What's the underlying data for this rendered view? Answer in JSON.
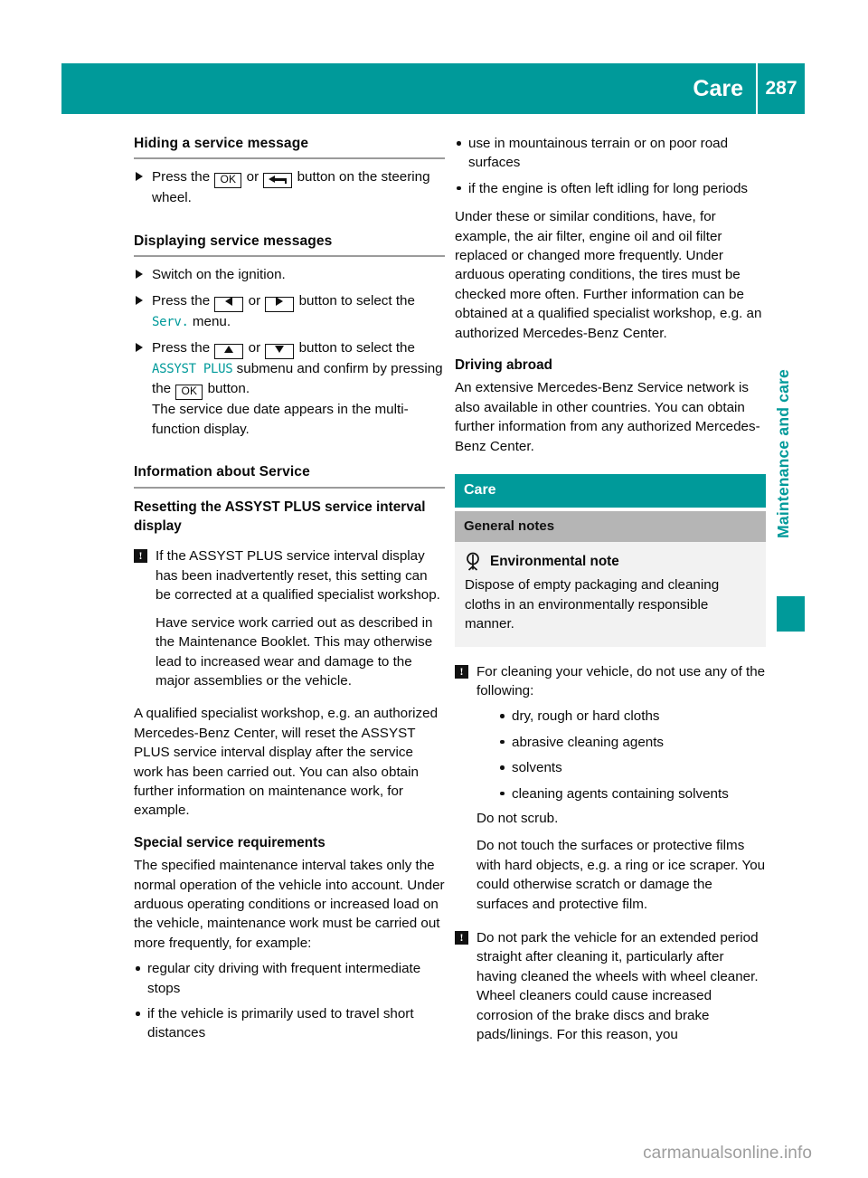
{
  "header": {
    "title": "Care",
    "page_number": "287"
  },
  "left_column": {
    "section1": {
      "heading": "Hiding a service message",
      "step1_pre": "Press the",
      "step1_key_ok": "OK",
      "step1_or": "or",
      "step1_key_back": "back-arrow-button",
      "step1_post": "button on the steering wheel."
    },
    "section2": {
      "heading": "Displaying service messages",
      "step1": "Switch on the ignition.",
      "step2_pre": "Press the",
      "step2_key_left": "left-arrow-button",
      "step2_or": "or",
      "step2_key_right": "right-arrow-button",
      "step2_mid": "button to select the",
      "step2_display": "Serv.",
      "step2_post": "menu.",
      "step3_pre": "Press the",
      "step3_key_up": "up-arrow-button",
      "step3_or": "or",
      "step3_key_down": "down-arrow-button",
      "step3_mid": "button to select the",
      "step3_display": "ASSYST PLUS",
      "step3_post": "submenu and confirm by pressing the",
      "step3_key_ok": "OK",
      "step3_tail": "button.",
      "step3_result": "The service due date appears in the multi-function display."
    },
    "section3": {
      "heading": "Information about Service",
      "sub_heading": "Resetting the ASSYST PLUS service interval display",
      "warning_icon": "warning-exclamation-icon",
      "warning_p1": "If the ASSYST PLUS service interval display has been inadvertently reset, this setting can be corrected at a qualified specialist workshop.",
      "warning_p2": "Have service work carried out as described in the Maintenance Booklet. This may otherwise lead to increased wear and damage to the major assemblies or the vehicle.",
      "para1": "A qualified specialist workshop, e.g. an authorized Mercedes-Benz Center, will reset the ASSYST PLUS service interval display after the service work has been carried out. You can also obtain further information on maintenance work, for example.",
      "sub_heading2": "Special service requirements",
      "para2": "The specified maintenance interval takes only the normal operation of the vehicle into account. Under arduous operating conditions or increased load on the vehicle, maintenance work must be carried out more frequently, for example:",
      "bullets": [
        "regular city driving with frequent intermediate stops",
        "if the vehicle is primarily used to travel short distances"
      ]
    }
  },
  "right_column": {
    "bullets_top": [
      "use in mountainous terrain or on poor road surfaces",
      "if the engine is often left idling for long periods"
    ],
    "para1": "Under these or similar conditions, have, for example, the air filter, engine oil and oil filter replaced or changed more frequently. Under arduous operating conditions, the tires must be checked more often. Further information can be obtained at a qualified specialist workshop, e.g. an authorized Mercedes-Benz Center.",
    "sub_heading": "Driving abroad",
    "para2": "An extensive Mercedes-Benz Service network is also available in other countries. You can obtain further information from any authorized Mercedes-Benz Center.",
    "care_band": "Care",
    "care_sub": "General notes",
    "env_icon": "environment-tree-icon",
    "env_label": "Environmental note",
    "env_text": "Dispose of empty packaging and cleaning cloths in an environmentally responsible manner.",
    "warning1_icon": "warning-exclamation-icon",
    "warning1_text": "For cleaning your vehicle, do not use any of the following:",
    "warning1_bullets": [
      "dry, rough or hard cloths",
      "abrasive cleaning agents",
      "solvents",
      "cleaning agents containing solvents"
    ],
    "warning1_tail1": "Do not scrub.",
    "warning1_tail2": "Do not touch the surfaces or protective films with hard objects, e.g. a ring or ice scraper. You could otherwise scratch or damage the surfaces and protective film.",
    "warning2_icon": "warning-exclamation-icon",
    "warning2_text": "Do not park the vehicle for an extended period straight after cleaning it, particularly after having cleaned the wheels with wheel cleaner. Wheel cleaners could cause increased corrosion of the brake discs and brake pads/linings. For this reason, you"
  },
  "side_tab": {
    "label": "Maintenance and care"
  },
  "watermark": "carmanualsonline.info",
  "colors": {
    "teal": "#009a9a",
    "gray_band": "#b5b5b5",
    "light_panel": "#f2f2f2",
    "rule": "#9b9b9b"
  }
}
